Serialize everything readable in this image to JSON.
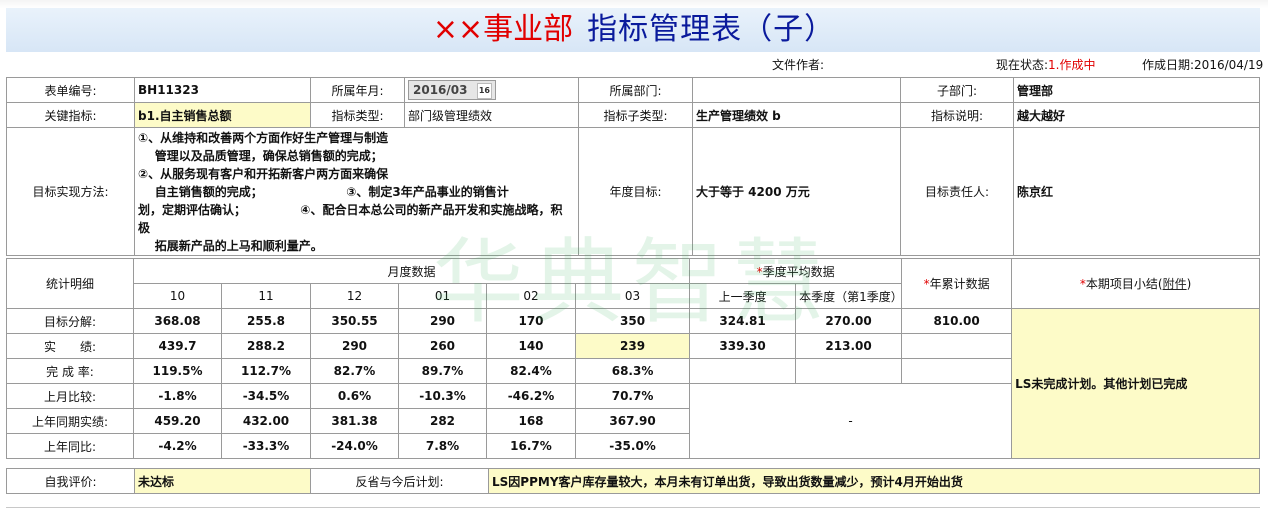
{
  "header": {
    "title_red": "××事业部",
    "title_blue": "指标管理表（子）",
    "author_label": "文件作者:",
    "status_label": "现在状态:",
    "status_value": "1.作成中",
    "created_label": "作成日期:",
    "created_value": "2016/04/19"
  },
  "form": {
    "form_no_label": "表单编号:",
    "form_no": "BH11323",
    "year_month_label": "所属年月:",
    "year_month": "2016/03",
    "calendar_icon_text": "16",
    "dept_label": "所属部门:",
    "dept_value": "",
    "sub_dept_label": "子部门:",
    "sub_dept": "管理部",
    "kpi_label": "关键指标:",
    "kpi": "b1.自主销售总额",
    "kpi_type_label": "指标类型:",
    "kpi_type": "部门级管理绩效",
    "kpi_subtype_label": "指标子类型:",
    "kpi_subtype": "生产管理绩效 b",
    "kpi_desc_label": "指标说明:",
    "kpi_desc": "越大越好",
    "method_label": "目标实现方法:",
    "method_lines": [
      "①、从维持和改善两个方面作好生产管理与制造",
      "    管理以及品质管理，确保总销售额的完成；",
      "②、从服务现有客户和开拓新客户两方面来确保",
      "    自主销售额的完成；                    ③、制定3年产品事业的销售计",
      "划，定期评估确认；             ④、配合日本总公司的新产品开发和实施战略，积",
      "极",
      "    拓展新产品的上马和顺利量产。"
    ],
    "annual_target_label": "年度目标:",
    "annual_target": "大于等于 4200 万元",
    "owner_label": "目标责任人:",
    "owner": "陈京红"
  },
  "stats": {
    "stat_label": "统计明细",
    "monthly_label": "月度数据",
    "quarterly_label": "季度平均数据",
    "annual_cum_label": "年累计数据",
    "summary_label": "本期项目小结(",
    "summary_link": "附件",
    "summary_close": ")",
    "months": [
      "10",
      "11",
      "12",
      "01",
      "02",
      "03"
    ],
    "q_prev": "上一季度",
    "q_curr": "本季度（第1季度）",
    "rows": [
      {
        "label": "目标分解:",
        "m": [
          "368.08",
          "255.8",
          "350.55",
          "290",
          "170",
          "350"
        ],
        "qp": "324.81",
        "qc": "270.00",
        "ann": "810.00"
      },
      {
        "label": "实　　绩:",
        "m": [
          "439.7",
          "288.2",
          "290",
          "260",
          "140",
          "239"
        ],
        "qp": "339.30",
        "qc": "213.00",
        "ann": ""
      },
      {
        "label": "完 成 率:",
        "m": [
          "119.5%",
          "112.7%",
          "82.7%",
          "89.7%",
          "82.4%",
          "68.3%"
        ],
        "qp": "",
        "qc": "",
        "ann": ""
      },
      {
        "label": "上月比较:",
        "m": [
          "-1.8%",
          "-34.5%",
          "0.6%",
          "-10.3%",
          "-46.2%",
          "70.7%"
        ]
      },
      {
        "label": "上年同期实绩:",
        "m": [
          "459.20",
          "432.00",
          "381.38",
          "282",
          "168",
          "367.90"
        ]
      },
      {
        "label": "上年同比:",
        "m": [
          "-4.2%",
          "-33.3%",
          "-24.0%",
          "7.8%",
          "16.7%",
          "-35.0%"
        ]
      }
    ],
    "dash": "-",
    "summary_text": "LS未完成计划。其他计划已完成"
  },
  "evaluation": {
    "self_label": "自我评价:",
    "self_value": "未达标",
    "plan_label": "反省与今后计划:",
    "plan_value": "LS因PPMY客户库存量较大，本月未有订单出货，导致出货数量减少，预计4月开始出货"
  },
  "watermark": "华典智慧"
}
